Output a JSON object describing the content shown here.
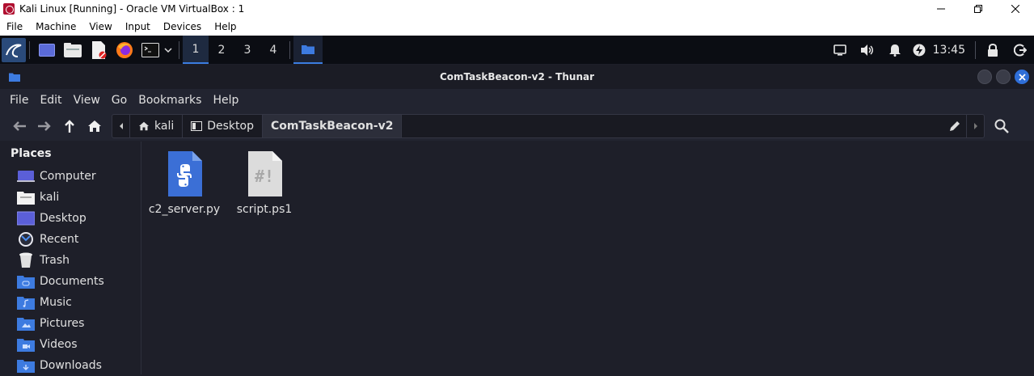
{
  "host_window": {
    "title": "Kali Linux [Running] - Oracle VM VirtualBox : 1",
    "menu": [
      "File",
      "Machine",
      "View",
      "Input",
      "Devices",
      "Help"
    ]
  },
  "panel": {
    "workspaces": [
      "1",
      "2",
      "3",
      "4"
    ],
    "active_workspace": "1",
    "clock": "13:45"
  },
  "thunar": {
    "title": "ComTaskBeacon-v2 - Thunar",
    "menu": [
      "File",
      "Edit",
      "View",
      "Go",
      "Bookmarks",
      "Help"
    ],
    "breadcrumbs": [
      "kali",
      "Desktop",
      "ComTaskBeacon-v2"
    ],
    "sidebar": {
      "heading": "Places",
      "items": [
        {
          "label": "Computer",
          "icon": "computer-icon"
        },
        {
          "label": "kali",
          "icon": "home-folder-icon"
        },
        {
          "label": "Desktop",
          "icon": "desktop-folder-icon"
        },
        {
          "label": "Recent",
          "icon": "recent-icon"
        },
        {
          "label": "Trash",
          "icon": "trash-icon"
        },
        {
          "label": "Documents",
          "icon": "documents-folder-icon"
        },
        {
          "label": "Music",
          "icon": "music-folder-icon"
        },
        {
          "label": "Pictures",
          "icon": "pictures-folder-icon"
        },
        {
          "label": "Videos",
          "icon": "videos-folder-icon"
        },
        {
          "label": "Downloads",
          "icon": "downloads-folder-icon"
        }
      ]
    },
    "files": [
      {
        "name": "c2_server.py",
        "icon": "python-file-icon",
        "color": "#3b6fd6"
      },
      {
        "name": "script.ps1",
        "icon": "script-file-icon",
        "color": "#d9d9d9"
      }
    ]
  },
  "colors": {
    "accent": "#3b7de0",
    "background": "#1e1f29",
    "folder": "#3d7be0"
  }
}
